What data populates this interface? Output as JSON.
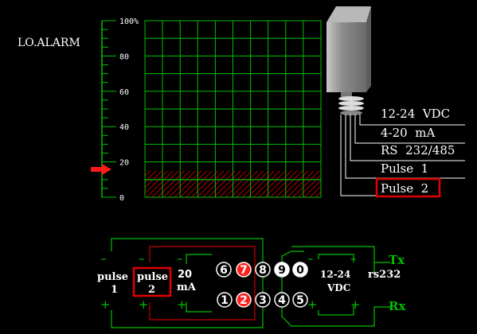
{
  "gauge": {
    "alarm_label": "LO.ALARM",
    "ticks": [
      "100%",
      "80",
      "60",
      "40",
      "20",
      "0"
    ],
    "level_percent": 15,
    "alarm_percent": 18
  },
  "sensor": {
    "outputs": [
      "12-24  VDC",
      "4-20  mA",
      "RS  232/485",
      "Pulse  1",
      "Pulse  2"
    ],
    "selected_output": "Pulse  2"
  },
  "wiring": {
    "label_pulse1": "pulse",
    "label_pulse1_num": "1",
    "label_pulse2": "pulse",
    "label_pulse2_num": "2",
    "label_ma_num": "20",
    "label_ma": "mA",
    "label_vdc_num": "12-24",
    "label_vdc": "VDC",
    "label_rs232": "rs232",
    "label_tx": "Tx",
    "label_rx": "Rx",
    "top_pins": [
      "6",
      "7",
      "8",
      "9",
      "0"
    ],
    "bottom_pins": [
      "1",
      "2",
      "3",
      "4",
      "5"
    ],
    "active_pins": [
      "7",
      "2"
    ],
    "minus": "–",
    "plus": "+"
  },
  "colors": {
    "grid": "#00c000",
    "alarm": "#ff1a1a",
    "highlight": "#e00000"
  }
}
